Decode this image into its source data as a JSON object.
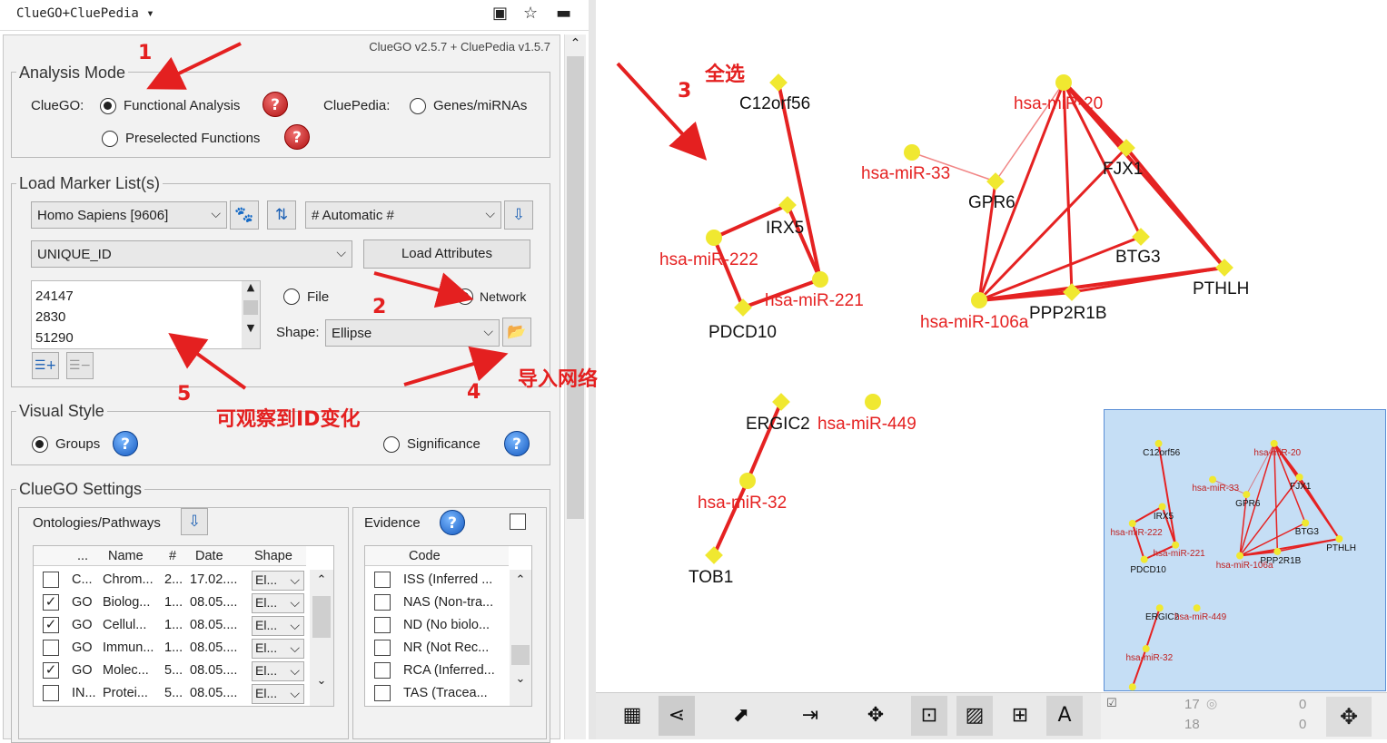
{
  "app": {
    "title": "ClueGO+CluePedia",
    "version": "ClueGO v2.5.7 + CluePedia v1.5.7"
  },
  "colors": {
    "annotation": "#e42020",
    "edge": "#e52222",
    "node": "#f0e830",
    "overview_bg": "#c5def5"
  },
  "analysis_mode": {
    "legend": "Analysis Mode",
    "cluego_label": "ClueGO:",
    "functional": "Functional Analysis",
    "preselected": "Preselected Functions",
    "cluepedia_label": "CluePedia:",
    "genes": "Genes/miRNAs",
    "help_icon": "?"
  },
  "load_marker": {
    "legend": "Load Marker List(s)",
    "organism": "Homo Sapiens [9606]",
    "automatic": "# Automatic #",
    "id_type": "UNIQUE_ID",
    "load_attributes": "Load Attributes",
    "ids": [
      "24147",
      "2830",
      "51290"
    ],
    "file": "File",
    "network": "Network",
    "shape_label": "Shape:",
    "shape_value": "Ellipse"
  },
  "visual_style": {
    "legend": "Visual Style",
    "groups": "Groups",
    "significance": "Significance"
  },
  "settings": {
    "legend": "ClueGO Settings",
    "ontologies_title": "Ontologies/Pathways",
    "evidence_title": "Evidence",
    "ont_headers": [
      "...",
      "Name",
      "#",
      "Date",
      "Shape"
    ],
    "ontologies": [
      {
        "checked": false,
        "dots": "C...",
        "name": "Chrom...",
        "num": "2...",
        "date": "17.02....",
        "shape": "El..."
      },
      {
        "checked": true,
        "dots": "GO",
        "name": "Biolog...",
        "num": "1...",
        "date": "08.05....",
        "shape": "El..."
      },
      {
        "checked": true,
        "dots": "GO",
        "name": "Cellul...",
        "num": "1...",
        "date": "08.05....",
        "shape": "El..."
      },
      {
        "checked": false,
        "dots": "GO",
        "name": "Immun...",
        "num": "1...",
        "date": "08.05....",
        "shape": "El..."
      },
      {
        "checked": true,
        "dots": "GO",
        "name": "Molec...",
        "num": "5...",
        "date": "08.05....",
        "shape": "El..."
      },
      {
        "checked": false,
        "dots": "IN...",
        "name": "Protei...",
        "num": "5...",
        "date": "08.05....",
        "shape": "El..."
      }
    ],
    "ev_header": "Code",
    "evidence": [
      "ISS (Inferred ...",
      "NAS (Non-tra...",
      "ND  (No biolo...",
      "NR  (Not Rec...",
      "RCA (Inferred...",
      "TAS (Tracea..."
    ]
  },
  "annotations": {
    "n1": "1",
    "n2": "2",
    "n3": "3",
    "n4": "4",
    "n5": "5",
    "select_all": "全选",
    "import_network": "导入网络",
    "observe_id": "可观察到ID变化"
  },
  "nodes": {
    "C12orf56": "C12orf56",
    "hsa_miR_20": "hsa-miR-20",
    "hsa_miR_33": "hsa-miR-33",
    "GPR6": "GPR6",
    "FJX1": "FJX1",
    "IRX5": "IRX5",
    "hsa_miR_222": "hsa-miR-222",
    "hsa_miR_221": "hsa-miR-221",
    "PDCD10": "PDCD10",
    "hsa_miR_106a": "hsa-miR-106a",
    "PPP2R1B": "PPP2R1B",
    "BTG3": "BTG3",
    "PTHLH": "PTHLH",
    "ERGIC2": "ERGIC2",
    "hsa_miR_449": "hsa-miR-449",
    "hsa_miR_32": "hsa-miR-32",
    "TOB1": "TOB1"
  },
  "status": {
    "nodes_total": "17",
    "nodes_total2": "18",
    "hidden1": "0",
    "hidden2": "0"
  }
}
